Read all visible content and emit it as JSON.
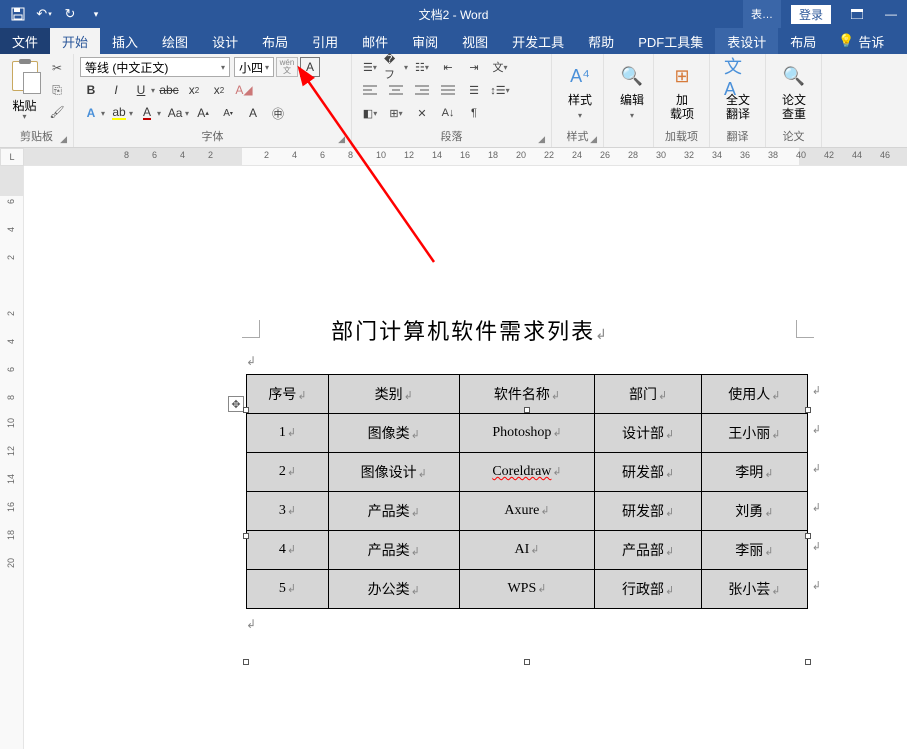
{
  "titlebar": {
    "doc_title": "文档2 - Word",
    "table_tools": "表…",
    "login": "登录"
  },
  "tabs": {
    "file": "文件",
    "home": "开始",
    "insert": "插入",
    "draw": "绘图",
    "design": "设计",
    "layout": "布局",
    "references": "引用",
    "mailings": "邮件",
    "review": "审阅",
    "view": "视图",
    "developer": "开发工具",
    "help": "帮助",
    "pdftools": "PDF工具集",
    "table_design": "表设计",
    "table_layout": "布局",
    "tell_me": "告诉"
  },
  "ribbon": {
    "clipboard": {
      "paste": "粘贴",
      "label": "剪贴板"
    },
    "font": {
      "name": "等线 (中文正文)",
      "size": "小四",
      "label": "字体",
      "wen": "wén"
    },
    "paragraph": {
      "label": "段落"
    },
    "styles": {
      "btn": "样式",
      "label": "样式"
    },
    "editing": {
      "btn": "编辑"
    },
    "addins": {
      "btn1": "加",
      "btn2": "载项",
      "label": "加载项"
    },
    "translate": {
      "btn1": "全文",
      "btn2": "翻译",
      "label": "翻译"
    },
    "check": {
      "btn1": "论文",
      "btn2": "查重",
      "label": "论文"
    }
  },
  "ruler": {
    "h": [
      "8",
      "6",
      "4",
      "2",
      "",
      "2",
      "4",
      "6",
      "8",
      "10",
      "12",
      "14",
      "16",
      "18",
      "20",
      "22",
      "24",
      "26",
      "28",
      "30",
      "32",
      "34",
      "36",
      "38",
      "40",
      "42",
      "44",
      "46"
    ],
    "v": [
      "6",
      "4",
      "2",
      "",
      "2",
      "4",
      "6",
      "8",
      "10",
      "12",
      "14",
      "16",
      "18",
      "20"
    ]
  },
  "doc": {
    "title": "部门计算机软件需求列表",
    "table_header": [
      "序号",
      "类别",
      "软件名称",
      "部门",
      "使用人"
    ],
    "rows": [
      [
        "1",
        "图像类",
        "Photoshop",
        "设计部",
        "王小丽"
      ],
      [
        "2",
        "图像设计",
        "Coreldraw",
        "研发部",
        "李明"
      ],
      [
        "3",
        "产品类",
        "Axure",
        "研发部",
        "刘勇"
      ],
      [
        "4",
        "产品类",
        "AI",
        "产品部",
        "李丽"
      ],
      [
        "5",
        "办公类",
        "WPS",
        "行政部",
        "张小芸"
      ]
    ],
    "spell_err_cell": [
      1,
      2
    ]
  }
}
